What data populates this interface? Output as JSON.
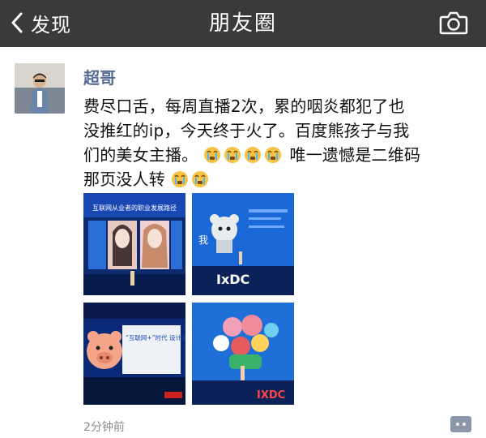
{
  "nav": {
    "back_label": "发现",
    "title": "朋友圈"
  },
  "post": {
    "username": "超哥",
    "text_line1": "费尽口舌，每周直播2次，累的咽炎都犯了也",
    "text_line2": "没推红的ip，今天终于火了。百度熊孩子与我",
    "text_line3a": "们的美女主播。",
    "text_line3b": "唯一遗憾是二维码",
    "text_line4": "那页没人转",
    "timestamp": "2分钟前",
    "images": [
      {
        "caption": "互联网从业者的职业发展路径"
      },
      {
        "caption": "我"
      },
      {
        "caption": "“互联网+”时代 设计进阶之路"
      },
      {
        "caption": "IXDC"
      }
    ]
  },
  "colors": {
    "nav_bg": "#3a3a3c",
    "username": "#586d95"
  },
  "icons": {
    "back": "chevron-left-icon",
    "camera": "camera-icon",
    "comment": "comment-icon",
    "emoji": "crying-face-emoji"
  }
}
